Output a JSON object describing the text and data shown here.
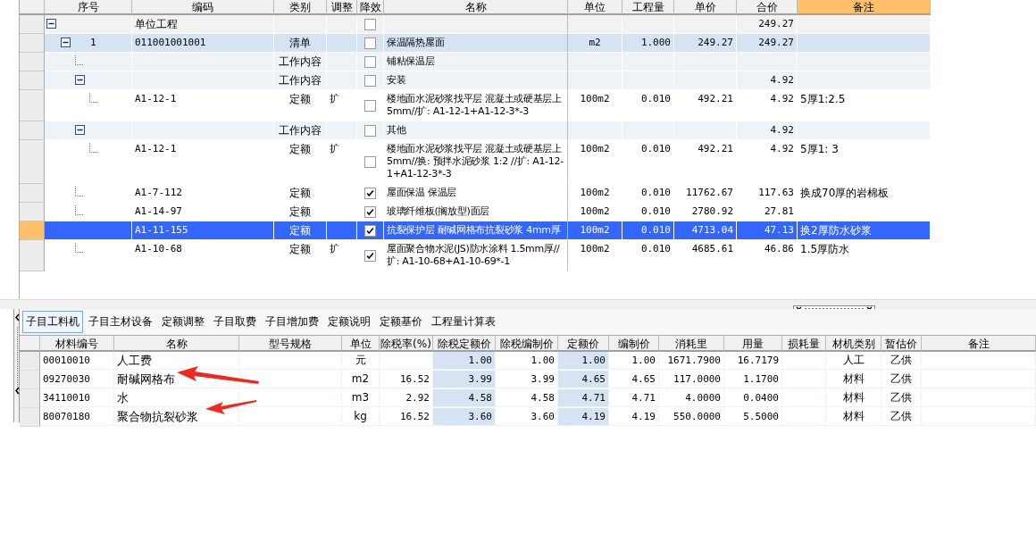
{
  "grid": {
    "columns": [
      {
        "label": "序号",
        "selected": false
      },
      {
        "label": "编码",
        "selected": false
      },
      {
        "label": "类别",
        "selected": false
      },
      {
        "label": "调整",
        "selected": false
      },
      {
        "label": "降效",
        "selected": false
      },
      {
        "label": "名称",
        "selected": false
      },
      {
        "label": "单位",
        "selected": false
      },
      {
        "label": "工程量",
        "selected": false
      },
      {
        "label": "单价",
        "selected": false
      },
      {
        "label": "合价",
        "selected": false
      },
      {
        "label": "备注",
        "selected": true
      }
    ],
    "rows": [
      {
        "kind": "project",
        "code": "单位工程",
        "reduced": false,
        "total": "249.27",
        "selected": false,
        "expanded": true,
        "children": [
          {
            "kind": "bill",
            "seq": "1",
            "code": "011001001001",
            "type": "清单",
            "reduced": false,
            "name": "保温隔热屋面",
            "unit": "m2",
            "qty": "1.000",
            "price": "249.27",
            "total": "249.27",
            "selected": false,
            "expanded": true,
            "children": [
              {
                "kind": "work",
                "type": "工作内容",
                "reduced": false,
                "name": "铺粘保温层",
                "selected": false
              },
              {
                "kind": "work",
                "type": "工作内容",
                "reduced": false,
                "name": "安装",
                "total": "4.92",
                "selected": false,
                "expanded": true,
                "children": [
                  {
                    "kind": "quota",
                    "code": "A1-12-1",
                    "type": "定额",
                    "adjust": "扩",
                    "reduced": false,
                    "name": "楼地面水泥砂浆找平层 混凝土或硬基层上 5mm//扩: A1-12-1+A1-12-3*-3",
                    "unit": "100m2",
                    "qty": "0.010",
                    "price": "492.21",
                    "total": "4.92",
                    "note": "5厚1:2.5",
                    "selected": false
                  }
                ]
              },
              {
                "kind": "work",
                "type": "工作内容",
                "reduced": false,
                "name": "其他",
                "total": "4.92",
                "selected": false,
                "expanded": true,
                "children": [
                  {
                    "kind": "quota",
                    "code": "A1-12-1",
                    "type": "定额",
                    "adjust": "扩",
                    "reduced": false,
                    "name": "楼地面水泥砂浆找平层 混凝土或硬基层上 5mm//换: 预拌水泥砂浆 1:2 //扩: A1-12-1+A1-12-3*-3",
                    "unit": "100m2",
                    "qty": "0.010",
                    "price": "492.21",
                    "total": "4.92",
                    "note": "5厚1: 3",
                    "selected": false
                  }
                ]
              },
              {
                "kind": "quota",
                "code": "A1-7-112",
                "type": "定额",
                "reduced": true,
                "name": "屋面保温 保温层",
                "unit": "100m2",
                "qty": "0.010",
                "price": "11762.67",
                "total": "117.63",
                "note": "换成70厚的岩棉板",
                "selected": false
              },
              {
                "kind": "quota",
                "code": "A1-14-97",
                "type": "定额",
                "reduced": true,
                "name": "玻璃纤维板(搁放型)面层",
                "unit": "100m2",
                "qty": "0.010",
                "price": "2780.92",
                "total": "27.81",
                "selected": false
              },
              {
                "kind": "quota",
                "code": "A1-11-155",
                "type": "定额",
                "reduced": true,
                "name": "抗裂保护层 耐碱网格布抗裂砂浆 4mm厚",
                "unit": "100m2",
                "qty": "0.010",
                "price": "4713.04",
                "total": "47.13",
                "note": "换2厚防水砂浆",
                "selected": true
              },
              {
                "kind": "quota",
                "code": "A1-10-68",
                "type": "定额",
                "adjust": "扩",
                "reduced": true,
                "name": "屋面聚合物水泥(JS)防水涂料 1.5mm厚//扩: A1-10-68+A1-10-69*-1",
                "unit": "100m2",
                "qty": "0.010",
                "price": "4685.61",
                "total": "46.86",
                "note": "1.5厚防水",
                "selected": false
              }
            ]
          }
        ]
      }
    ]
  },
  "tabs": [
    {
      "label": "子目工料机",
      "selected": true
    },
    {
      "label": "子目主材设备",
      "selected": false
    },
    {
      "label": "定额调整",
      "selected": false
    },
    {
      "label": "子目取费",
      "selected": false
    },
    {
      "label": "子目增加费",
      "selected": false
    },
    {
      "label": "定额说明",
      "selected": false
    },
    {
      "label": "定额基价",
      "selected": false
    },
    {
      "label": "工程量计算表",
      "selected": false
    }
  ],
  "materials": {
    "columns": [
      {
        "label": "材料编号",
        "shaded": false
      },
      {
        "label": "名称",
        "shaded": false
      },
      {
        "label": "型号规格",
        "shaded": false
      },
      {
        "label": "单位",
        "shaded": false
      },
      {
        "label": "除税率(%)",
        "shaded": false
      },
      {
        "label": "除税定额价",
        "shaded": true
      },
      {
        "label": "除税编制价",
        "shaded": false
      },
      {
        "label": "定额价",
        "shaded": true
      },
      {
        "label": "编制价",
        "shaded": false
      },
      {
        "label": "消耗里",
        "shaded": false
      },
      {
        "label": "用量",
        "shaded": false
      },
      {
        "label": "损耗量",
        "shaded": false
      },
      {
        "label": "材机类别",
        "shaded": false
      },
      {
        "label": "暂估价",
        "shaded": false
      },
      {
        "label": "备注",
        "shaded": false
      }
    ],
    "rows": [
      {
        "code": "00010010",
        "name": "人工费",
        "unit": "元",
        "net_quota": "1.00",
        "net_budget": "1.00",
        "quota": "1.00",
        "budget": "1.00",
        "consumption": "1671.7900",
        "usage": "16.7179",
        "category": "人工",
        "provisional": "乙供"
      },
      {
        "code": "09270030",
        "name": "耐碱网格布",
        "unit": "m2",
        "tax": "16.52",
        "net_quota": "3.99",
        "net_budget": "3.99",
        "quota": "4.65",
        "budget": "4.65",
        "consumption": "117.0000",
        "usage": "1.1700",
        "category": "材料",
        "provisional": "乙供"
      },
      {
        "code": "34110010",
        "name": "水",
        "unit": "m3",
        "tax": "2.92",
        "net_quota": "4.58",
        "net_budget": "4.58",
        "quota": "4.71",
        "budget": "4.71",
        "consumption": "4.0000",
        "usage": "0.0400",
        "category": "材料",
        "provisional": "乙供"
      },
      {
        "code": "80070180",
        "name": "聚合物抗裂砂浆",
        "unit": "kg",
        "tax": "16.52",
        "net_quota": "3.60",
        "net_budget": "3.60",
        "quota": "4.19",
        "budget": "4.19",
        "consumption": "550.0000",
        "usage": "5.5000",
        "category": "材料",
        "provisional": "乙供"
      }
    ]
  }
}
